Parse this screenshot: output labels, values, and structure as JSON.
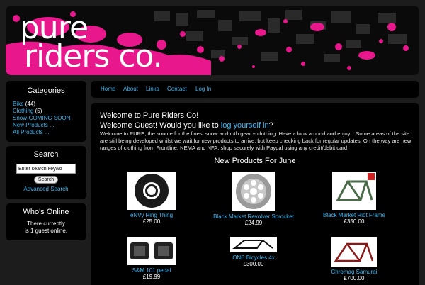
{
  "logo": {
    "line1": "pure",
    "line2": "riders co."
  },
  "sidebar": {
    "categories_title": "Categories",
    "categories": [
      {
        "label": "Bike",
        "count": "(44)"
      },
      {
        "label": "Clothing",
        "count": "(5)"
      },
      {
        "label": "Snow-COMING SOON",
        "count": ""
      },
      {
        "label": "New Products ...",
        "count": ""
      },
      {
        "label": "All Products ...",
        "count": ""
      }
    ],
    "search_title": "Search",
    "search_placeholder": "Enter search keywo",
    "search_button": "Search",
    "advanced_search": "Advanced Search",
    "whos_online_title": "Who's Online",
    "whos_online_line1": "There currently",
    "whos_online_line2": "is 1 guest online."
  },
  "nav": {
    "items": [
      "Home",
      "About",
      "Links",
      "Contact",
      "Log In"
    ]
  },
  "main": {
    "welcome_title": "Welcome to Pure Riders Co!",
    "welcome_guest_prefix": "Welcome Guest! Would you like to ",
    "login_link": "log yourself in",
    "welcome_guest_suffix": "?",
    "intro": "Welcome to PURE, the source for the finest snow and mtb gear + clothing. Have a look around and enjoy... Some areas of the site are still being developed whilst we wait for new products to arrive, but keep checking back for regular updates. On the way are new ranges of clothing from Frontline, NEMA and NFA. shop securely with Paypal using any credit/debit card",
    "new_products_title": "New Products For June",
    "products": [
      {
        "name": "eNVy Ring Thing",
        "price": "£25.00"
      },
      {
        "name": "Black Market Revolver Sprocket",
        "price": "£24.99"
      },
      {
        "name": "Black Market Riot Frame",
        "price": "£350.00"
      },
      {
        "name": "S&M 101 pedal",
        "price": "£19.99"
      },
      {
        "name": "ONE Bicycles 4x",
        "price": "£300.00"
      },
      {
        "name": "Chromag Samurai",
        "price": "£700.00"
      }
    ]
  },
  "colors": {
    "accent": "#e8188c",
    "link": "#3cb6f0"
  }
}
